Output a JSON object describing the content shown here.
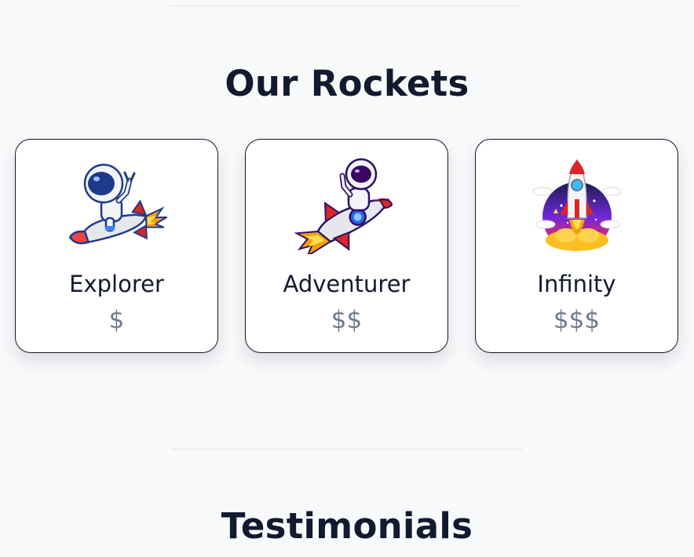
{
  "sections": {
    "rockets_title": "Our Rockets",
    "testimonials_title": "Testimonials"
  },
  "rockets": [
    {
      "name": "Explorer",
      "price": "$",
      "icon": "astronaut-riding-rocket-icon"
    },
    {
      "name": "Adventurer",
      "price": "$$",
      "icon": "astronaut-waving-on-rocket-icon"
    },
    {
      "name": "Infinity",
      "price": "$$$",
      "icon": "rocket-launch-icon"
    }
  ],
  "colors": {
    "background": "#f8f9fb",
    "title": "#111a2e",
    "price": "#6b7a8f",
    "card_border": "#111827"
  }
}
